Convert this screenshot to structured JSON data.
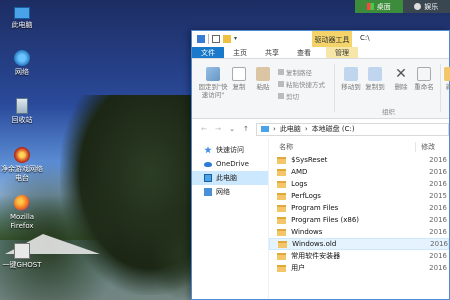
{
  "desktop": {
    "icons": [
      {
        "label": "此电脑"
      },
      {
        "label": "网络"
      },
      {
        "label": "回收站"
      },
      {
        "label": "净余游戏网络电台"
      },
      {
        "label": "Mozilla Firefox"
      },
      {
        "label": "一键GHOST"
      }
    ]
  },
  "taskbar": {
    "desktop_label": "桌面",
    "game_label": "娱乐"
  },
  "window": {
    "contextual_tab": "驱动器工具",
    "title_path": "C:\\",
    "tabs": [
      "文件",
      "主页",
      "共享",
      "查看",
      "管理"
    ],
    "ribbon": {
      "pin_label": "固定到\"快速访问\"",
      "copy_label": "复制",
      "paste_label": "粘贴",
      "copy_path_label": "复制路径",
      "paste_shortcut_label": "粘贴快捷方式",
      "cut_label": "剪切",
      "move_to_label": "移动到",
      "copy_to_label": "复制到",
      "delete_label": "删除",
      "rename_label": "重命名",
      "new_label": "新",
      "organize_group": "组织"
    },
    "address": {
      "crumb1": "此电脑",
      "crumb2": "本地磁盘 (C:)"
    },
    "nav": [
      "快速访问",
      "OneDrive",
      "此电脑",
      "网络"
    ],
    "columns": {
      "name": "名称",
      "date": "修改"
    },
    "files": [
      {
        "name": "$SysReset",
        "date": "2016"
      },
      {
        "name": "AMD",
        "date": "2016"
      },
      {
        "name": "Logs",
        "date": "2016"
      },
      {
        "name": "PerfLogs",
        "date": "2015"
      },
      {
        "name": "Program Files",
        "date": "2016"
      },
      {
        "name": "Program Files (x86)",
        "date": "2016"
      },
      {
        "name": "Windows",
        "date": "2016"
      },
      {
        "name": "Windows.old",
        "date": "2016"
      },
      {
        "name": "常用软件安装器",
        "date": "2016"
      },
      {
        "name": "用户",
        "date": "2016"
      }
    ]
  }
}
